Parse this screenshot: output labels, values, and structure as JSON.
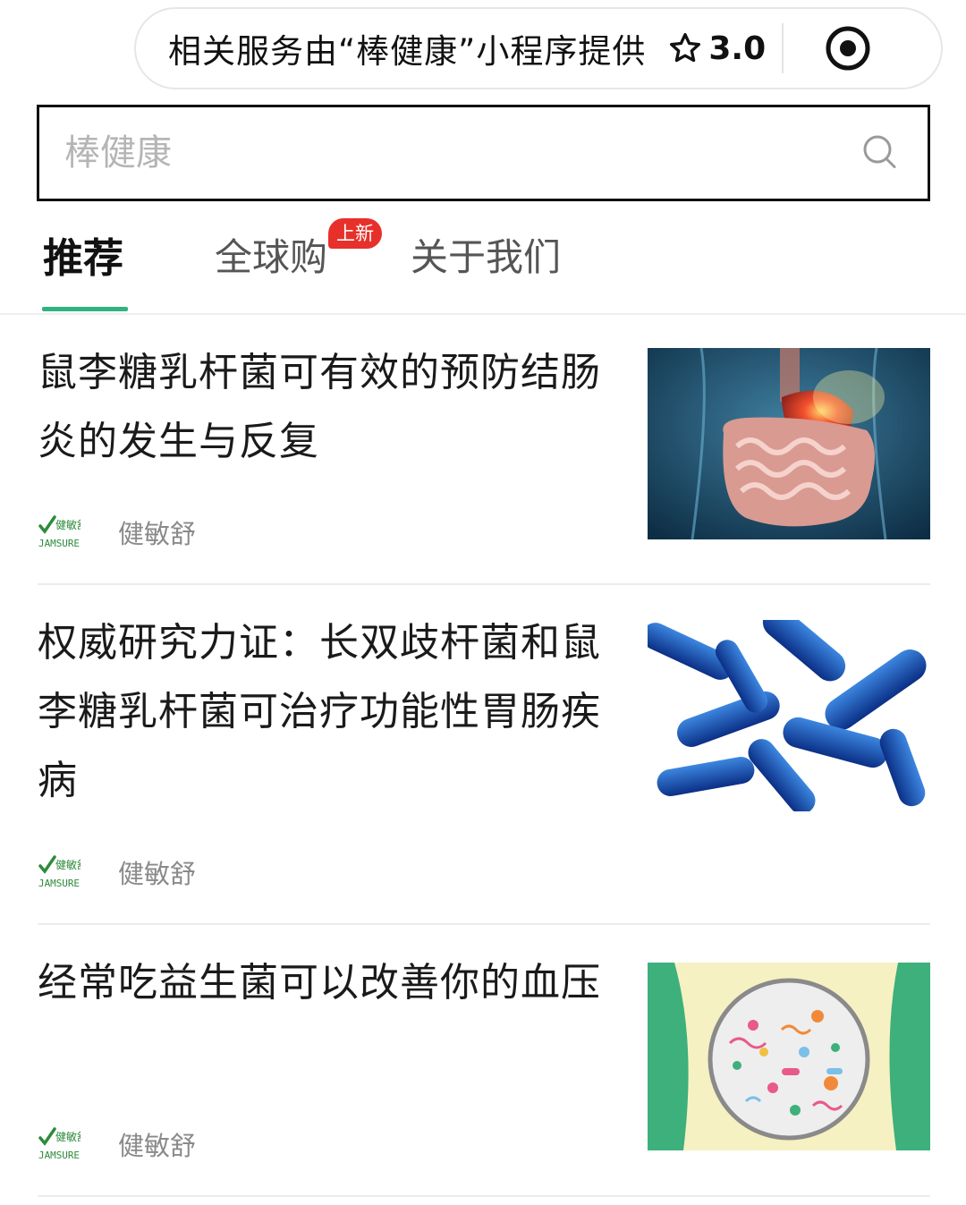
{
  "capsule": {
    "text": "相关服务由“棒健康”小程序提供",
    "rating": "3.0",
    "star_icon": "star-outline-icon",
    "menu_icon": "target-icon"
  },
  "search": {
    "placeholder": "棒健康",
    "icon": "search-icon"
  },
  "tabs": [
    {
      "label": "推荐",
      "active": true
    },
    {
      "label": "全球购",
      "badge": "上新"
    },
    {
      "label": "关于我们"
    }
  ],
  "colors": {
    "accent": "#2fb37e",
    "badge": "#e8302a",
    "brand_green": "#2e8b3a"
  },
  "articles": [
    {
      "title": "鼠李糖乳杆菌可有效的预防结肠炎的发生与反复",
      "source": "健敏舒",
      "logo_text": "健敏舒",
      "logo_sub": "JAMSURE",
      "thumb": "digestive-system-image"
    },
    {
      "title": "权威研究力证：长双歧杆菌和鼠李糖乳杆菌可治疗功能性胃肠疾病",
      "source": "健敏舒",
      "logo_text": "健敏舒",
      "logo_sub": "JAMSURE",
      "thumb": "bacteria-image"
    },
    {
      "title": "经常吃益生菌可以改善你的血压",
      "source": "健敏舒",
      "logo_text": "健敏舒",
      "logo_sub": "JAMSURE",
      "thumb": "gut-microbiome-image"
    }
  ]
}
